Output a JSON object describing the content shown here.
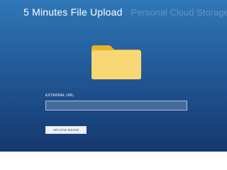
{
  "header": {
    "title": "5 Minutes File Upload",
    "subtitle": "Personal Cloud Storage"
  },
  "folder": {
    "icon": "folder-icon",
    "color_front": "#f8d775",
    "color_back": "#e9b325"
  },
  "form": {
    "url_label": "EXTERNAL URL:",
    "url_value": "",
    "upload_button_label": "UPLOAD IMAGE"
  },
  "colors": {
    "background_top": "#2f77b7",
    "background_bottom": "#15386e"
  }
}
